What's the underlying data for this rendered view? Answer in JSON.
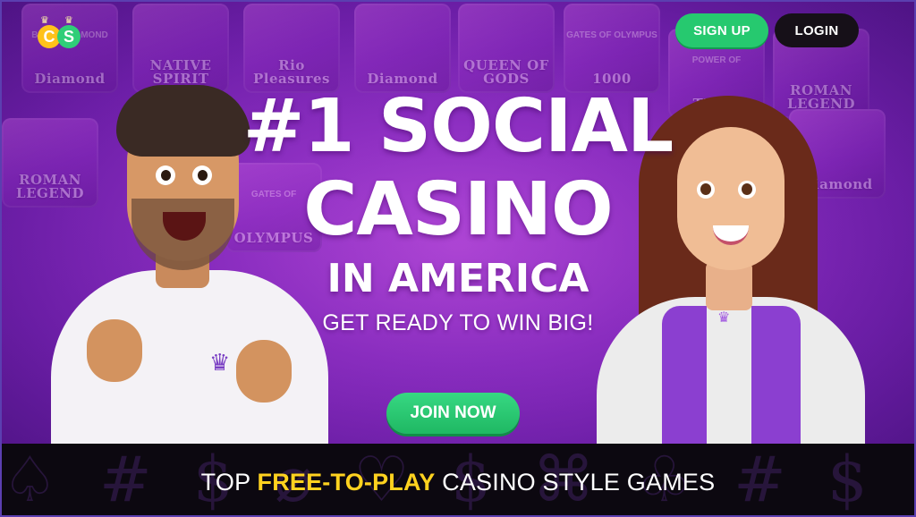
{
  "header": {
    "logo_letters": [
      "C",
      "S"
    ],
    "signup_label": "SIGN UP",
    "login_label": "LOGIN"
  },
  "hero": {
    "headline_line1": "#1 SOCIAL",
    "headline_line2": "CASINO",
    "headline_line3": "IN AMERICA",
    "tagline": "GET READY TO WIN BIG!",
    "join_label": "JOIN NOW",
    "background_tiles": [
      {
        "label": "Diamond",
        "sub": "BLACK DIAMOND"
      },
      {
        "label": "NATIVE SPIRIT",
        "sub": ""
      },
      {
        "label": "Rio Pleasures",
        "sub": ""
      },
      {
        "label": "Diamond",
        "sub": ""
      },
      {
        "label": "QUEEN OF GODS",
        "sub": ""
      },
      {
        "label": "1000",
        "sub": "GATES OF OLYMPUS"
      },
      {
        "label": "THOR",
        "sub": "POWER OF"
      },
      {
        "label": "ROMAN LEGEND",
        "sub": ""
      },
      {
        "label": "ROMAN LEGEND",
        "sub": ""
      },
      {
        "label": "OLYMPUS",
        "sub": "GATES OF"
      },
      {
        "label": "Diamond",
        "sub": ""
      }
    ]
  },
  "bottom_banner": {
    "prefix": "TOP",
    "highlight": "FREE-TO-PLAY",
    "suffix": "CASINO STYLE GAMES",
    "glyphs": "♤ # $ ⌀ ♡ $ ⌘ ♧ # $ ♡ ♤ # $ ⌀ ♡ $ ⌘ ♧"
  },
  "colors": {
    "hero_purple": "#8a2fc2",
    "signup_green": "#26c96f",
    "login_black": "#161018",
    "join_green": "#1fb863",
    "highlight_yellow": "#ffd21f",
    "band_black": "#0c0810"
  },
  "icons": {
    "crown": "crown-icon",
    "logo": "casino-logo-icon"
  }
}
